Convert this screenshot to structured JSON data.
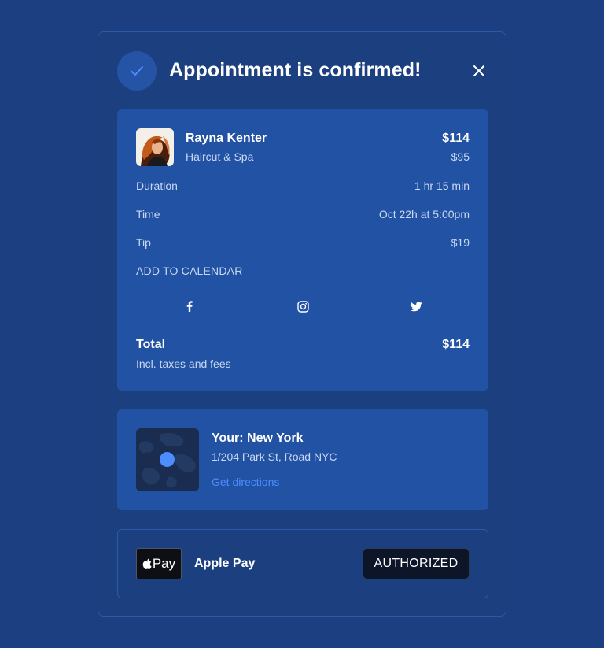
{
  "header": {
    "title": "Appointment is confirmed!",
    "icon": "check-icon",
    "close_icon": "close-icon"
  },
  "booking": {
    "name": "Rayna Kenter",
    "service": "Haircut & Spa",
    "price": "$114",
    "base_price": "$95",
    "details": [
      {
        "label": "Duration",
        "value": "1 hr 15 min"
      },
      {
        "label": "Time",
        "value": "Oct 22h at 5:00pm"
      },
      {
        "label": "Tip",
        "value": "$19"
      }
    ],
    "add_to_calendar": "ADD TO CALENDAR",
    "social_icons": [
      "facebook-icon",
      "instagram-icon",
      "twitter-icon"
    ],
    "total_label": "Total",
    "total_value": "$114",
    "total_note": "Incl. taxes and fees"
  },
  "location": {
    "title": "Your: New York",
    "address": "1/204 Park St, Road NYC",
    "link": "Get directions"
  },
  "payment": {
    "badge_text": "Pay",
    "method": "Apple Pay",
    "status": "AUTHORIZED"
  },
  "colors": {
    "background": "#1b3f80",
    "card": "#2252a3",
    "accent": "#4c8dff",
    "status_badge": "#0d1528"
  }
}
